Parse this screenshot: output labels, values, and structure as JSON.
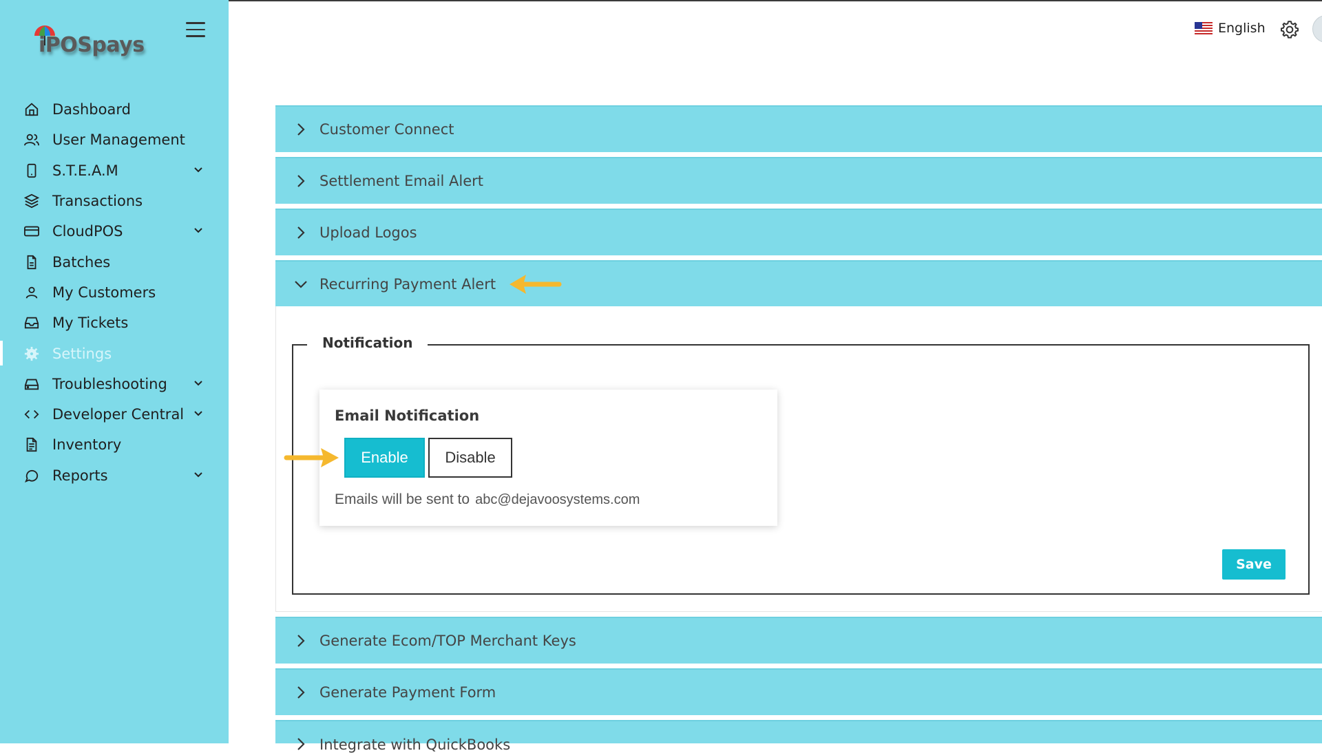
{
  "app": {
    "logo_text": "iPOSpays"
  },
  "header": {
    "language_label": "English"
  },
  "sidebar": {
    "items": [
      {
        "label": "Dashboard",
        "icon": "home-icon"
      },
      {
        "label": "User Management",
        "icon": "users-icon"
      },
      {
        "label": "S.T.E.A.M",
        "icon": "phone-icon",
        "expandable": true
      },
      {
        "label": "Transactions",
        "icon": "layers-icon"
      },
      {
        "label": "CloudPOS",
        "icon": "card-icon",
        "expandable": true
      },
      {
        "label": "Batches",
        "icon": "file-icon"
      },
      {
        "label": "My Customers",
        "icon": "user-icon"
      },
      {
        "label": "My Tickets",
        "icon": "inbox-icon"
      },
      {
        "label": "Settings",
        "icon": "gear-icon",
        "active": true
      },
      {
        "label": "Troubleshooting",
        "icon": "drive-icon",
        "expandable": true
      },
      {
        "label": "Developer Central",
        "icon": "code-icon",
        "expandable": true
      },
      {
        "label": "Inventory",
        "icon": "document-icon"
      },
      {
        "label": "Reports",
        "icon": "message-icon",
        "expandable": true
      }
    ]
  },
  "sections": {
    "customer_connect": "Customer Connect",
    "settlement_email_alert": "Settlement Email Alert",
    "upload_logos": "Upload Logos",
    "recurring_payment_alert": "Recurring Payment Alert",
    "generate_keys": "Generate Ecom/TOP Merchant Keys",
    "generate_payment_form": "Generate Payment Form",
    "integrate_quickbooks": "Integrate with QuickBooks"
  },
  "notification": {
    "legend": "Notification",
    "card_title": "Email Notification",
    "enable_label": "Enable",
    "disable_label": "Disable",
    "selected": "Enable",
    "emails_prefix": "Emails will be sent to",
    "email_address": "abc@dejavoosystems.com",
    "save_label": "Save"
  },
  "colors": {
    "sidebar_bg": "#7fdbe9",
    "accent": "#16bdd0",
    "annotation_arrow": "#f5b82e"
  }
}
